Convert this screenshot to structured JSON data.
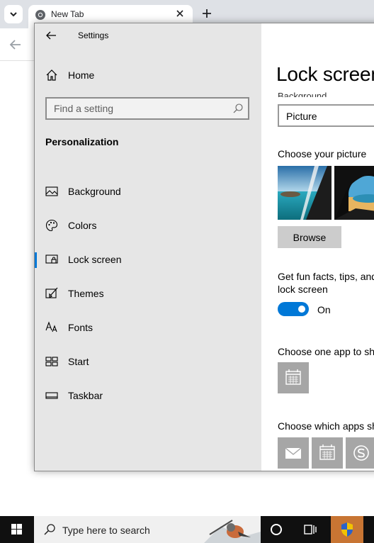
{
  "browser": {
    "tab_title": "New Tab",
    "icons": [
      "chevron-down-icon",
      "chrome-logo-icon",
      "close-icon",
      "plus-icon",
      "back-arrow-icon"
    ]
  },
  "settings": {
    "app_title": "Settings",
    "home_label": "Home",
    "search": {
      "placeholder": "Find a setting",
      "value": ""
    },
    "section_header": "Personalization",
    "nav_items": [
      {
        "label": "Background",
        "icon": "picture-icon",
        "selected": false
      },
      {
        "label": "Colors",
        "icon": "palette-icon",
        "selected": false
      },
      {
        "label": "Lock screen",
        "icon": "lock-screen-icon",
        "selected": true
      },
      {
        "label": "Themes",
        "icon": "brush-icon",
        "selected": false
      },
      {
        "label": "Fonts",
        "icon": "font-icon",
        "selected": false
      },
      {
        "label": "Start",
        "icon": "start-icon",
        "selected": false
      },
      {
        "label": "Taskbar",
        "icon": "taskbar-icon",
        "selected": false
      }
    ],
    "accent_color": "#0078d7"
  },
  "content": {
    "page_title": "Lock screen",
    "background_label": "Background",
    "background_value": "Picture",
    "choose_picture_label": "Choose your picture",
    "browse_label": "Browse",
    "fun_facts_line1": "Get fun facts, tips, and",
    "fun_facts_line2": "lock screen",
    "toggle_label": "On",
    "toggle_on": true,
    "choose_one_app_label": "Choose one app to sh",
    "choose_which_apps_label": "Choose which apps sh"
  },
  "taskbar": {
    "search_placeholder": "Type here to search",
    "icons": [
      "windows-logo-icon",
      "search-icon",
      "cortana-icon",
      "task-view-icon",
      "shield-icon"
    ]
  }
}
